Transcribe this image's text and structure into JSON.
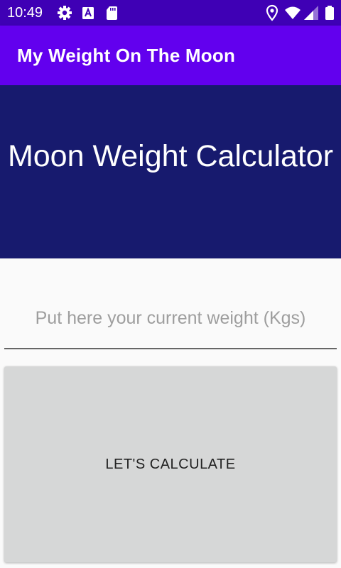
{
  "status_bar": {
    "time": "10:49",
    "icons": [
      "gear-icon",
      "accessibility-a-icon",
      "sd-card-icon",
      "location-pin-icon",
      "wifi-icon",
      "signal-icon",
      "battery-icon"
    ],
    "background": "#3f00b5"
  },
  "app_bar": {
    "title": "My Weight On The Moon",
    "background": "#6200ee"
  },
  "hero": {
    "title": "Moon Weight Calculator",
    "background": "#171a6e"
  },
  "weight_input": {
    "value": "",
    "placeholder": "Put here your current weight (Kgs)"
  },
  "calculate_button": {
    "label": "LET'S CALCULATE",
    "background": "#d6d7d7"
  }
}
